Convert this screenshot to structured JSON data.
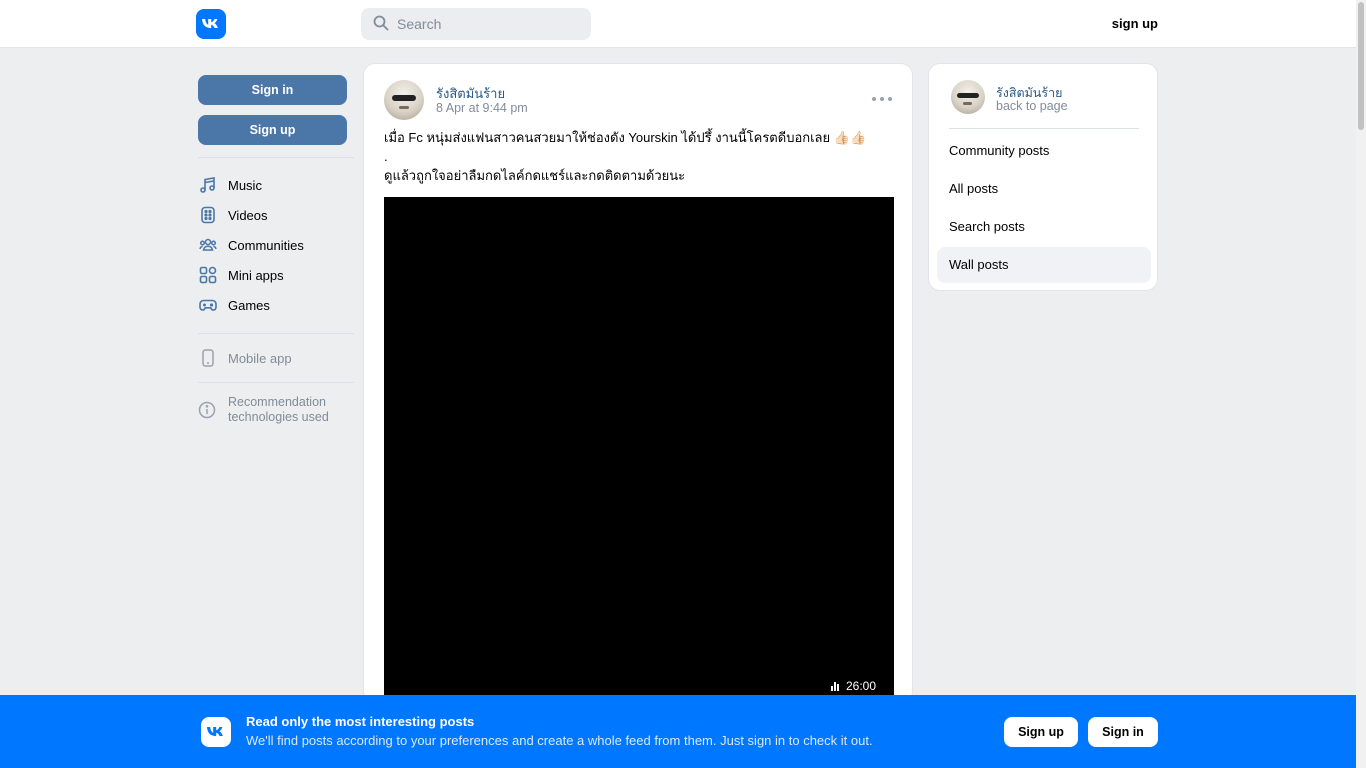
{
  "header": {
    "search_placeholder": "Search",
    "signup_label": "sign up"
  },
  "left": {
    "signin_label": "Sign in",
    "signup_label": "Sign up",
    "nav": [
      {
        "label": "Music",
        "icon": "music-icon"
      },
      {
        "label": "Videos",
        "icon": "videos-icon"
      },
      {
        "label": "Communities",
        "icon": "communities-icon"
      },
      {
        "label": "Mini apps",
        "icon": "mini-apps-icon"
      },
      {
        "label": "Games",
        "icon": "games-icon"
      }
    ],
    "mobile_app_label": "Mobile app",
    "recommendation_label": "Recommendation technologies used"
  },
  "post": {
    "author": "รังสิตมันร้าย",
    "date": "8 Apr at 9:44 pm",
    "text_line1": "เมื่อ Fc หนุ่มส่งแฟนสาวคนสวยมาให้ช่องดัง Yourskin ได้ปรึ้ งานนี้โครตดีบอกเลย 👍🏻👍🏻",
    "text_line2": ".",
    "text_line3": "ดูแล้วถูกใจอย่าลืมกดไลค์กดแชร์และกดติดตามด้วยนะ",
    "video_duration": "26:00"
  },
  "right": {
    "name": "รังสิตมันร้าย",
    "back_label": "back to page",
    "menu": [
      {
        "label": "Community posts",
        "active": false
      },
      {
        "label": "All posts",
        "active": false
      },
      {
        "label": "Search posts",
        "active": false
      },
      {
        "label": "Wall posts",
        "active": true
      }
    ]
  },
  "banner": {
    "title": "Read only the most interesting posts",
    "subtitle": "We'll find posts according to your preferences and create a whole feed from them. Just sign in to check it out.",
    "signup_label": "Sign up",
    "signin_label": "Sign in"
  },
  "colors": {
    "brand": "#0077ff",
    "button_blue": "#4a76a8",
    "link": "#2a5885",
    "muted": "#818c99",
    "background": "#edeef0"
  }
}
